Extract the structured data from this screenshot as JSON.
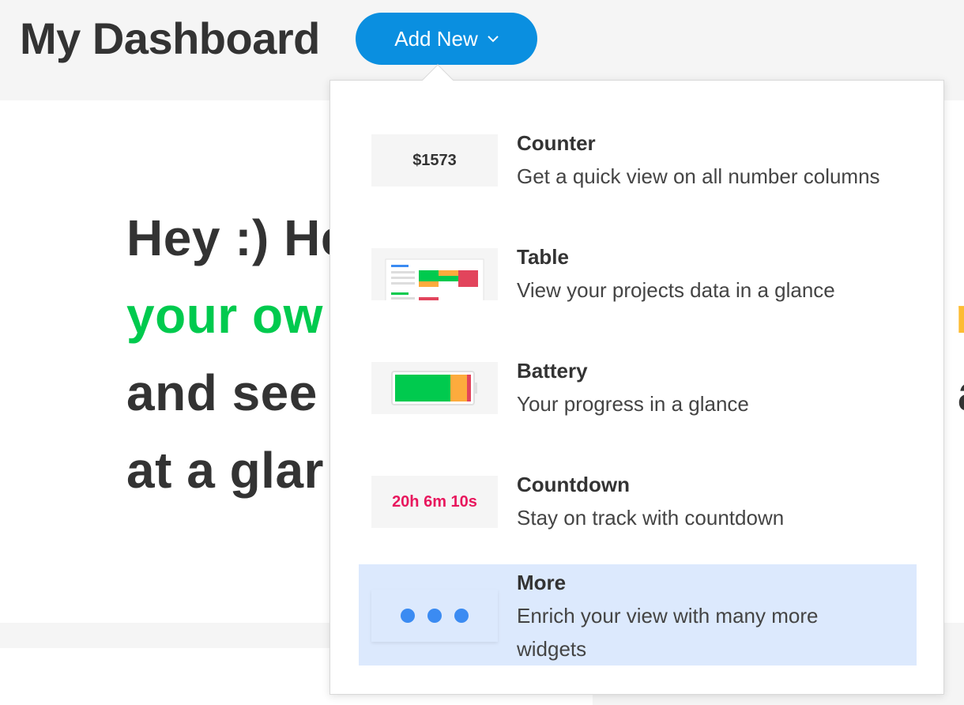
{
  "header": {
    "title": "My Dashboard",
    "add_new_label": "Add New"
  },
  "greeting": {
    "line1": "Hey :) He",
    "line2_green": "your ow",
    "line2_yellow": "r",
    "line3_start": "and see",
    "line3_end": "a",
    "line4": "at a glar"
  },
  "colors": {
    "accent": "#0a8fe0",
    "green": "#00ca4e",
    "yellow": "#fdbc32",
    "red": "#e8175d",
    "highlight": "#dce9fd",
    "dots": "#3b8bf2"
  },
  "menu": {
    "items": [
      {
        "title": "Counter",
        "description": "Get a quick view on all number columns",
        "thumb_text": "$1573",
        "icon": "counter-thumbnail"
      },
      {
        "title": "Table",
        "description": "View your projects data in a glance",
        "icon": "table-thumbnail"
      },
      {
        "title": "Battery",
        "description": "Your progress in a glance",
        "icon": "battery-thumbnail"
      },
      {
        "title": "Countdown",
        "description": "Stay on track with countdown",
        "thumb_text": "20h 6m 10s",
        "icon": "countdown-thumbnail"
      },
      {
        "title": "More",
        "description": "Enrich your view with many more widgets",
        "icon": "more-dots-icon",
        "highlighted": true
      }
    ]
  }
}
